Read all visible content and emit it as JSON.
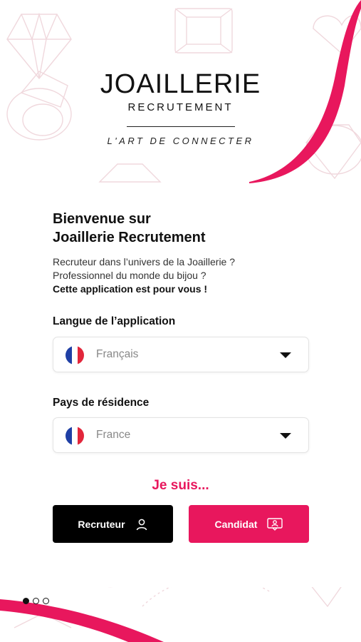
{
  "brand": {
    "name": "JOAILLERIE",
    "subtitle": "RECRUTEMENT",
    "tagline": "L'ART DE CONNECTER"
  },
  "welcome": {
    "line1": "Bienvenue sur",
    "line2": "Joaillerie Recrutement",
    "intro_line1": "Recruteur dans l’univers de la Joaillerie ?",
    "intro_line2": "Professionnel du monde du bijou ?",
    "intro_bold": "Cette application est pour vous !"
  },
  "language": {
    "label": "Langue de l’application",
    "value": "Français",
    "flag": "france-flag"
  },
  "country": {
    "label": "Pays de résidence",
    "value": "France",
    "flag": "france-flag"
  },
  "role": {
    "prompt": "Je suis...",
    "recruiter_label": "Recruteur",
    "candidate_label": "Candidat",
    "recruiter_icon": "user-icon",
    "candidate_icon": "badge-icon"
  },
  "pagination": {
    "current": 1,
    "total": 3
  },
  "colors": {
    "accent": "#e8175d",
    "dark": "#000000",
    "flag_blue": "#1f3fa5",
    "flag_white": "#ffffff",
    "flag_red": "#e2263b"
  }
}
